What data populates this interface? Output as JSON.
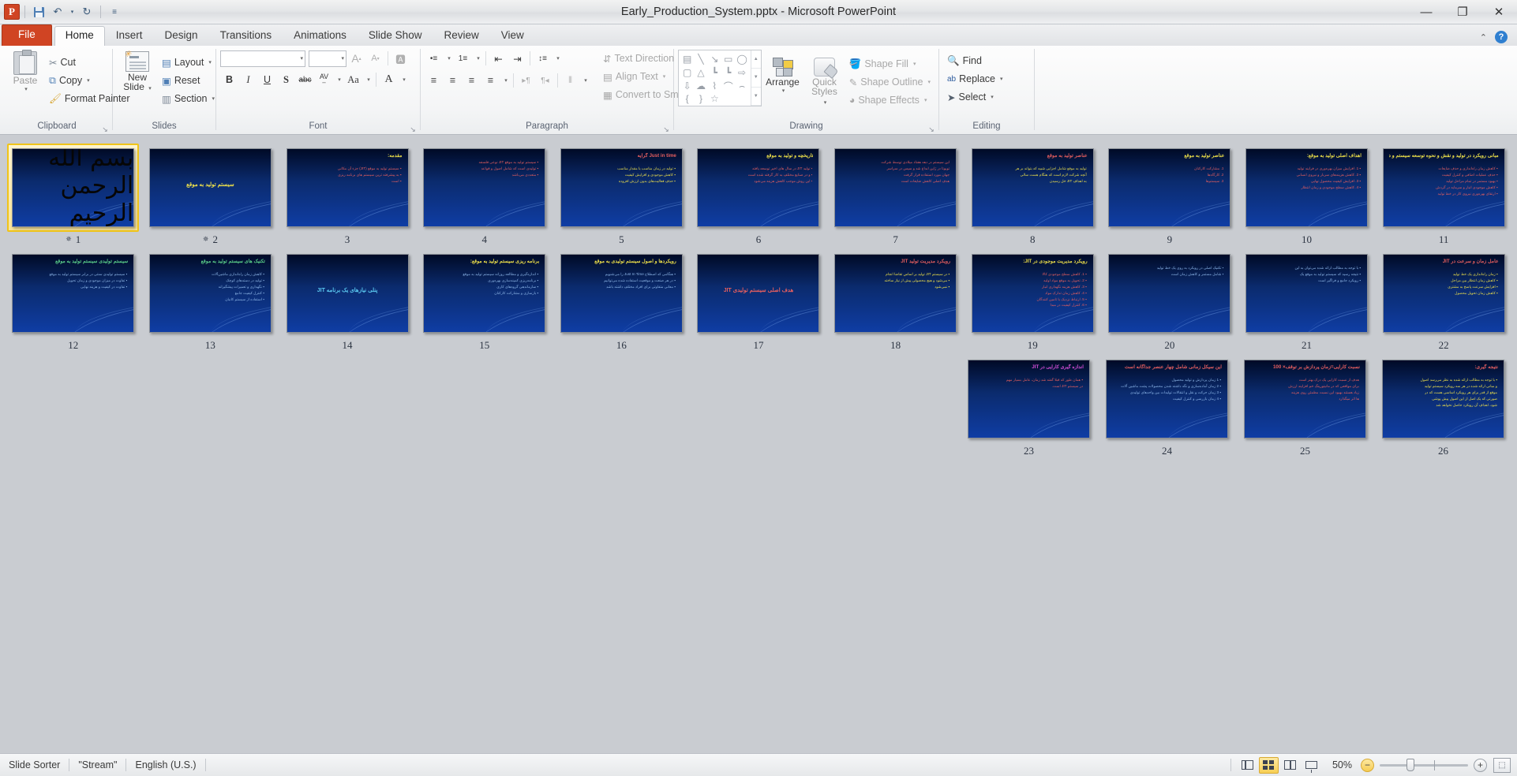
{
  "titlebar": {
    "app_icon": "powerpoint-logo",
    "document_title": "Early_Production_System.pptx  -  Microsoft PowerPoint",
    "qat": [
      {
        "name": "save",
        "icon": "save-icon"
      },
      {
        "name": "undo",
        "icon": "undo-icon",
        "glyph": "↶"
      },
      {
        "name": "undo-dropdown",
        "icon": "chevron-down-icon",
        "glyph": "▾"
      },
      {
        "name": "redo",
        "icon": "redo-icon",
        "glyph": "↻"
      },
      {
        "name": "customize-qat",
        "icon": "chevron-down-icon",
        "glyph": "≡"
      }
    ],
    "window_controls": {
      "minimize": "—",
      "restore": "❐",
      "close": "✕"
    }
  },
  "tabs": {
    "file": "File",
    "items": [
      {
        "label": "Home",
        "active": true
      },
      {
        "label": "Insert",
        "active": false
      },
      {
        "label": "Design",
        "active": false
      },
      {
        "label": "Transitions",
        "active": false
      },
      {
        "label": "Animations",
        "active": false
      },
      {
        "label": "Slide Show",
        "active": false
      },
      {
        "label": "Review",
        "active": false
      },
      {
        "label": "View",
        "active": false
      }
    ],
    "collapse_ribbon": "⌃",
    "help": "?"
  },
  "ribbon": {
    "clipboard": {
      "label": "Clipboard",
      "paste": "Paste",
      "cut": "Cut",
      "copy": "Copy",
      "format_painter": "Format Painter",
      "dialog_launcher": "↘"
    },
    "slides": {
      "label": "Slides",
      "new_slide": "New\nSlide",
      "new_slide_line1": "New",
      "new_slide_line2": "Slide",
      "layout": "Layout",
      "reset": "Reset",
      "section": "Section"
    },
    "font": {
      "label": "Font",
      "font_family_value": "",
      "font_size_value": "",
      "grow_font": "A",
      "shrink_font": "A",
      "clear_formatting": "Aa",
      "bold": "B",
      "italic": "I",
      "underline": "U",
      "shadow": "S",
      "strikethrough": "abc",
      "character_spacing": "AV",
      "change_case": "Aa",
      "font_color": "A",
      "dialog_launcher": "↘"
    },
    "paragraph": {
      "label": "Paragraph",
      "bullets": "•≡",
      "numbering": "1≡",
      "decrease_indent": "⇤",
      "increase_indent": "⇥",
      "line_spacing": "↕≡",
      "align_left": "≡",
      "align_center": "≡",
      "align_right": "≡",
      "justify": "≡",
      "ltr": "▸¶",
      "rtl": "¶◂",
      "columns": "⦀",
      "text_direction": "Text Direction",
      "align_text": "Align Text",
      "convert_to_smartart": "Convert to SmartArt",
      "dialog_launcher": "↘"
    },
    "drawing": {
      "label": "Drawing",
      "shapes": [
        "▤",
        "╲",
        "↘",
        "▭",
        "◯",
        "▢",
        "△",
        "┗",
        "┗",
        "⇨",
        "⇩",
        "☁",
        "⌇",
        "⌒",
        "⌢",
        "{",
        "}",
        "☆"
      ],
      "scroll_up": "▲",
      "scroll_down": "▼",
      "more_shapes": "▼",
      "arrange": "Arrange",
      "quick_styles_line1": "Quick",
      "quick_styles_line2": "Styles",
      "shape_fill": "Shape Fill",
      "shape_outline": "Shape Outline",
      "shape_effects": "Shape Effects",
      "dialog_launcher": "↘"
    },
    "editing": {
      "label": "Editing",
      "find": "Find",
      "replace": "Replace",
      "select": "Select"
    }
  },
  "sorter": {
    "rows": [
      [
        {
          "num": "11",
          "kind": "content",
          "selected": false,
          "anim": false,
          "title": "مبانی رویکرد در تولید و نقش و نحوه توسعه سیستم و دیدگاه فرایندی در دنیا",
          "body": [
            "▪ کاهش زمان راه‌اندازی و حذف ضایعات",
            "▪ حذف عملیات اضافی و کنترل کیفیت",
            "▪ بهبود مستمر در تمام مراحل تولید",
            "▪ کاهش موجودی انبار و سرمایه در گردش",
            "▪ ارتقای بهره‌وری نیروی کار در خط تولید"
          ],
          "title_color": "#f0e24a",
          "body_color": "#e85f5f"
        },
        {
          "num": "10",
          "kind": "content",
          "selected": false,
          "anim": false,
          "title": "اهداف اصلی تولید به موقع:",
          "body": [
            "▪ 1. افزایش میزان بهره‌وری در فرایند تولید",
            "▪ 2. کاهش هزینه‌های سربار و نیروی انسانی",
            "▪ 3. افزایش کیفیت محصول نهایی",
            "▪ 4. کاهش سطح موجودی و زمان انتظار"
          ],
          "title_color": "#f0e24a",
          "body_color": "#e85f5f"
        },
        {
          "num": "9",
          "kind": "content",
          "selected": false,
          "anim": false,
          "title": "عناصر تولید به موقع",
          "body": [
            "1. مشارکت کارکنان",
            "2. کارگاه‌ها",
            "3. سیستم‌ها"
          ],
          "title_color": "#f0e24a",
          "body_color": "#e85f5f"
        },
        {
          "num": "8",
          "kind": "content",
          "selected": false,
          "anim": false,
          "title": "عناصر تولید به موقع",
          "body": [
            "تولید به موقع شامل اجزایی شبیه که بتواند بر هر",
            "آنچه شرکت لازم است که هنگام هست سالی",
            "به اهداف JIT خل رسیدن"
          ],
          "title_color": "#e85f5f",
          "body_color": "#f0e24a"
        },
        {
          "num": "7",
          "kind": "content",
          "selected": false,
          "anim": false,
          "title": "",
          "body": [
            "این سیستم در دهه هفتاد میلادی توسط شرکت",
            "تویوتا در ژاپن ابداع شد و سپس در سراسر",
            "جهان مورد استفاده قرار گرفت",
            "هدف اصلی کاهش ضایعات است"
          ],
          "title_color": "#f0e24a",
          "body_color": "#e85f5f"
        },
        {
          "num": "6",
          "kind": "content",
          "selected": false,
          "anim": false,
          "title": "تاریخچه و تولید به موقع",
          "body": [
            "▪ تولید JIT در سال های اخیر توسعه یافته",
            "▪ و در صنایع مختلف به کار گرفته شده است",
            "▪ این روش موجب کاهش هزینه می‌شود"
          ],
          "title_color": "#f0e24a",
          "body_color": "#e85f5f"
        },
        {
          "num": "5",
          "kind": "content",
          "selected": false,
          "anim": false,
          "title": "Just in time گرایه",
          "body": [
            "▪ تولید در زمان مناسب با مقدار مناسب",
            "▪ کاهش موجودی و افزایش کیفیت",
            "▪ حذف فعالیت‌های بدون ارزش افزوده"
          ],
          "title_color": "#e85f5f",
          "body_color": "#f0e24a"
        },
        {
          "num": "4",
          "kind": "content",
          "selected": false,
          "anim": false,
          "title": "",
          "body": [
            "▪ سیستم تولید به موقع JIT نوعی فلسفه",
            "▪ تولیدی است که شامل اصول و قواعد",
            "▪ متعددی می‌باشد"
          ],
          "title_color": "#f0e24a",
          "body_color": "#e85f5f"
        },
        {
          "num": "3",
          "kind": "content",
          "selected": false,
          "anim": false,
          "title": "مقدمه:",
          "body": [
            "▪ سیستم تولید به موقع (JIT) جزء آن مکانی",
            "▪ به پیشرفته ترین سیستم های برنامه ریزی",
            "▪ است"
          ],
          "title_color": "#f0e24a",
          "body_color": "#e85f5f"
        },
        {
          "num": "2",
          "kind": "title-only",
          "selected": false,
          "anim": true,
          "center_text": "سیستم تولید به موقع",
          "title_color": "#f0e24a"
        },
        {
          "num": "1",
          "kind": "bismillah",
          "selected": true,
          "anim": true,
          "center_text": "بسم الله الرحمن الرحیم"
        }
      ],
      [
        {
          "num": "22",
          "kind": "content",
          "selected": false,
          "anim": false,
          "title": "عامل زمان و سرعت در JIT",
          "body": [
            "▪ زمان راه‌اندازی یک خط تولید",
            "▪ کاهش زمان انتظار بین مراحل",
            "▪ افزایش سرعت پاسخ به مشتری",
            "▪ کاهش زمان تحویل محصول"
          ],
          "title_color": "#e85f5f",
          "body_color": "#f0e24a"
        },
        {
          "num": "21",
          "kind": "content",
          "selected": false,
          "anim": false,
          "title": "",
          "body": [
            "▪ با توجه به مطالب ارائه شده می‌توان به این",
            "▪ نتیجه رسید که سیستم تولید به موقع یک",
            "▪ رویکرد جامع و فراگیر است"
          ],
          "title_color": "#f0e24a",
          "body_color": "#8fb8ea"
        },
        {
          "num": "20",
          "kind": "content",
          "selected": false,
          "anim": false,
          "title": "",
          "body": [
            "▪ تکنیک اصلی در رویکرد به روی یک خط تولید",
            "▪ شامل مستمر و کاهش زمان است"
          ],
          "title_color": "#f0e24a",
          "body_color": "#8fb8ea"
        },
        {
          "num": "19",
          "kind": "content",
          "selected": false,
          "anim": false,
          "title": "رویکرد مدیریت موجودی در JIT:",
          "body": [
            "▪ 1. کاهش سطح موجودی کالا",
            "▪ 2. تحویل به موقع مواد اولیه",
            "▪ 3. کاهش هزینه نگهداری انبار",
            "▪ 4. کاهش زمان تدارک مواد",
            "▪ 5. ارتباط نزدیک با تامین کنندگان",
            "▪ 6. کنترل کیفیت در مبدا"
          ],
          "title_color": "#f0e24a",
          "body_color": "#e85f5f"
        },
        {
          "num": "18",
          "kind": "content",
          "selected": false,
          "anim": false,
          "title": "رویکرد مدیریت تولید JIT",
          "body": [
            "▪ در سیستم JIT تولید بر اساس تقاضا انجام",
            "▪ می‌شود و هیچ محصولی پیش از نیاز ساخته",
            "▪ نمی‌شود"
          ],
          "title_color": "#e85f5f",
          "body_color": "#f0e24a"
        },
        {
          "num": "17",
          "kind": "title-only",
          "selected": false,
          "anim": false,
          "center_text": "هدف اصلی سیستم تولیدی JIT",
          "title_color": "#e85f5f"
        },
        {
          "num": "16",
          "kind": "content",
          "selected": false,
          "anim": false,
          "title": "رویکردها و اصول سیستم تولیدی به موقع",
          "body": [
            "▪ هنگامی که اصطلاح Just In Time را می‌شنویم",
            "▪ در هر صنعت و موقعیت استفاده شده می‌توانیم",
            "▪ معانی متفاوتی برای افراد مختلف داشته باشد"
          ],
          "title_color": "#f0e24a",
          "body_color": "#8fb8ea"
        },
        {
          "num": "15",
          "kind": "content",
          "selected": false,
          "anim": false,
          "title": "برنامه ریزی سیستم تولید به موقع:",
          "body": [
            "▪ اندازه‌گیری و مطالعه روزانه سیستم تولید به موقع",
            "▪ برنامه‌ریزی کمینه‌سازی بهره‌وری",
            "▪ سازماندهی گروه‌های کاری",
            "▪ بازسازی و مشارکت کارکنان"
          ],
          "title_color": "#f0e24a",
          "body_color": "#8fb8ea"
        },
        {
          "num": "14",
          "kind": "title-only",
          "selected": false,
          "anim": false,
          "center_text": "پنلی نیازهای یک برنامه JIT",
          "title_color": "#5bc8f0"
        },
        {
          "num": "13",
          "kind": "content",
          "selected": false,
          "anim": false,
          "title": "تکنیک های سیستم تولید به موقع",
          "body": [
            "▪ کاهش زمان راه‌اندازی ماشین‌آلات",
            "▪ تولید در دسته‌های کوچک",
            "▪ نگهداری و تعمیرات پیشگیرانه",
            "▪ کنترل کیفیت جامع",
            "▪ استفاده از سیستم کانبان"
          ],
          "title_color": "#5bd08a",
          "body_color": "#8fb8ea"
        },
        {
          "num": "12",
          "kind": "content",
          "selected": false,
          "anim": false,
          "title": "سیستم تولیدی  سیستم تولید به موقع",
          "body": [
            "▪ سیستم تولیدی سنتی در برابر سیستم تولید به موقع",
            "▪ تفاوت در میزان موجودی و زمان تحویل",
            "▪ تفاوت در کیفیت و هزینه نهایی"
          ],
          "title_color": "#5bd08a",
          "body_color": "#8fb8ea"
        }
      ],
      [
        {
          "num": "26",
          "kind": "content",
          "selected": false,
          "anim": false,
          "title": "نتیجه گیری:",
          "body": [
            "▪ با توجه به مطالب ارائه شده به نظر می‌رسد اصول",
            "و مبانی ارائه شده در هر سه رویکرد سیستم تولید",
            "موقع از قدر برای هر رویکرد اساسی هست که در",
            "صورتی که یک اصل از این اصول پیش پوشی",
            "شود، اهداف آن رویکرد حاصل نخواهد شد"
          ],
          "title_color": "#e85f5f",
          "body_color": "#f0e24a"
        },
        {
          "num": "25",
          "kind": "content",
          "selected": false,
          "anim": false,
          "title": "نسبت کارایی=زمان پردازش بر توقف× 100",
          "body": [
            "هدف از نسبت کارایی یک درک بهتر است",
            "برای مواقعی که در مانیتورینگ خم افزایند ارزش",
            "زیاد هستند بهبود این نسبت مطمئن روی هزینه",
            "ها اثر میگذارد"
          ],
          "title_color": "#e85f5f",
          "body_color": "#e85f5f"
        },
        {
          "num": "24",
          "kind": "content",
          "selected": false,
          "anim": false,
          "title": "این سیکل زمانی شامل چهار عنصر جداگانه است",
          "body": [
            "▪ 1 زمان پردازش و تولید محصول",
            "▪ 2 زمان آماده‌سازی و نگه داشته شدن محصولات پشت ماشین آلات",
            "▪ 3 زمان حرکت و نقل و انتقالات تولیدات بین واحدهای تولیدی",
            "▪ 4 زمان بازرسی و کنترل کیفیت"
          ],
          "title_color": "#e85f5f",
          "body_color": "#8fb8ea"
        },
        {
          "num": "23",
          "kind": "content",
          "selected": false,
          "anim": false,
          "title": "اندازه گیری کارایی در JIT",
          "body": [
            "▪ همان طور که قبلا گفته شد زمان، عامل بسیار مهم",
            "در سیستم JIT است."
          ],
          "title_color": "#d84fd8",
          "body_color": "#e85f5f"
        }
      ]
    ]
  },
  "statusbar": {
    "view_name": "Slide Sorter",
    "theme_name": "\"Stream\"",
    "language": "English (U.S.)",
    "views": [
      {
        "name": "normal-view",
        "label": "Normal",
        "active": false
      },
      {
        "name": "slide-sorter-view",
        "label": "Slide Sorter",
        "active": true
      },
      {
        "name": "reading-view",
        "label": "Reading View",
        "active": false
      },
      {
        "name": "slide-show-view",
        "label": "Slide Show",
        "active": false
      }
    ],
    "zoom_level": "50%",
    "zoom_out": "−",
    "zoom_in": "+",
    "fit_to_window": "⬚"
  }
}
